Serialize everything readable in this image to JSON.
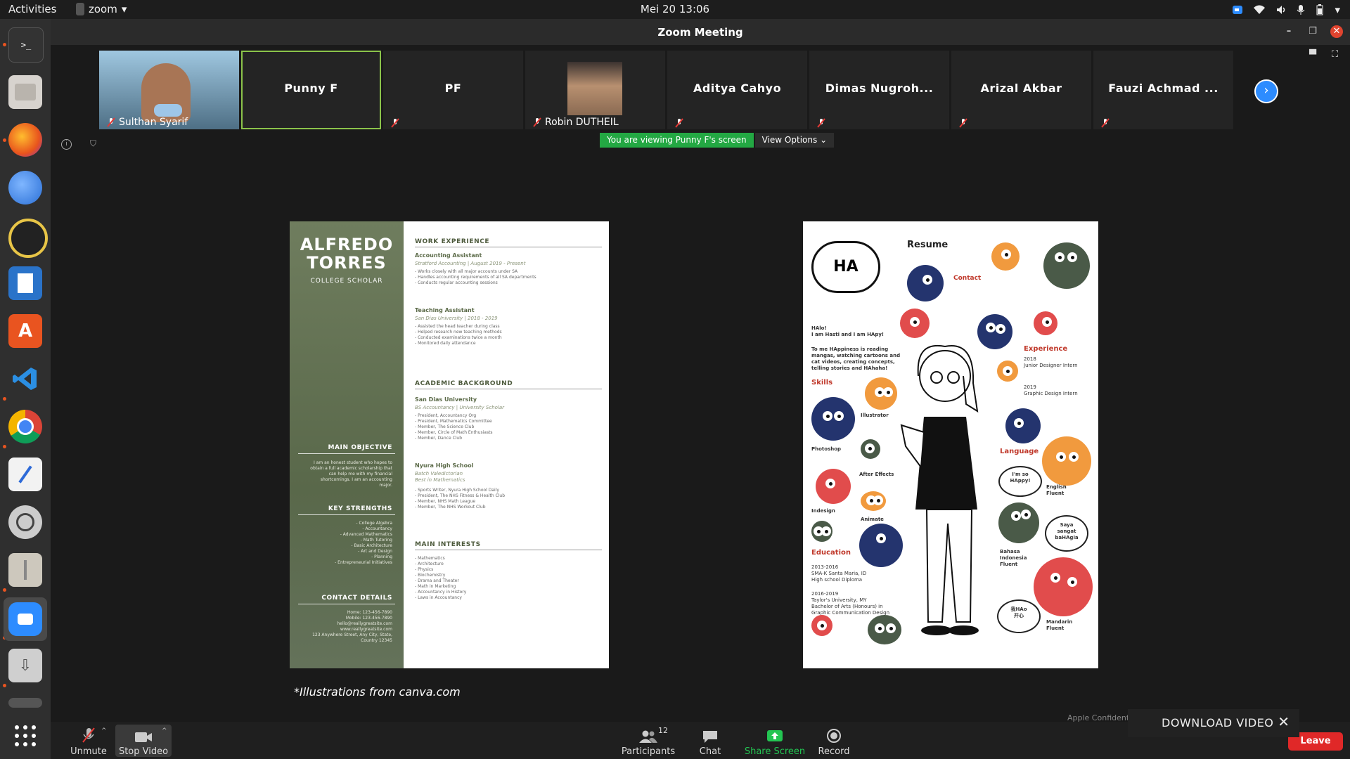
{
  "topbar": {
    "activities": "Activities",
    "app_name": "zoom",
    "clock": "Mei 20  13:06"
  },
  "window": {
    "title": "Zoom Meeting"
  },
  "participants_strip": [
    {
      "name": "Sulthan Syarif",
      "label": "Sulthan Syarif",
      "has_video": true,
      "muted": true,
      "active": false
    },
    {
      "name": "Punny F",
      "label": "",
      "has_video": false,
      "muted": false,
      "active": true
    },
    {
      "name": "PF",
      "label": "",
      "has_video": false,
      "muted": true,
      "active": false
    },
    {
      "name": "Robin DUTHEIL",
      "label": "Robin DUTHEIL",
      "has_video": true,
      "muted": true,
      "active": false
    },
    {
      "name": "Aditya Cahyo",
      "label": "",
      "has_video": false,
      "muted": true,
      "active": false
    },
    {
      "name": "Dimas Nugroh...",
      "label": "",
      "has_video": false,
      "muted": true,
      "active": false
    },
    {
      "name": "Arizal Akbar",
      "label": "",
      "has_video": false,
      "muted": true,
      "active": false
    },
    {
      "name": "Fauzi Achmad ...",
      "label": "",
      "has_video": false,
      "muted": true,
      "active": false
    }
  ],
  "share": {
    "notice": "You are viewing Punny F's screen",
    "view_options": "View Options"
  },
  "resume_left": {
    "first_name": "ALFREDO",
    "last_name": "TORRES",
    "subtitle": "COLLEGE SCHOLAR",
    "main_objective_head": "MAIN OBJECTIVE",
    "main_objective_text": "I am an honest student who hopes to obtain a full academic scholarship that can help me with my financial shortcomings. I am an accounting major.",
    "strengths_head": "KEY STRENGTHS",
    "strengths_text": "- College Algebra\n- Accountancy\n- Advanced Mathematics\n- Math Tutoring\n- Basic Architecture\n- Art and Design\n- Planning\n- Entrepreneurial Initiatives",
    "contact_head": "CONTACT DETAILS",
    "contact_text": "Home: 123-456-7890\nMobile: 123-456-7890\nhello@reallygreatsite.com\nwww.reallygreatsite.com\n123 Anywhere Street, Any City, State, Country 12345",
    "work_head": "WORK EXPERIENCE",
    "job1_title": "Accounting Assistant",
    "job1_meta": "Stratford Accounting | August 2019 - Present",
    "job1_bullets": "- Works closely with all major accounts under SA\n- Handles accounting requirements of all SA departments\n- Conducts regular accounting sessions",
    "job2_title": "Teaching Assistant",
    "job2_meta": "San Dias University | 2018 - 2019",
    "job2_bullets": "- Assisted the head teacher during class\n- Helped research new teaching methods\n- Conducted examinations twice a month\n- Monitored daily attendance",
    "academic_head": "ACADEMIC BACKGROUND",
    "school1": "San Dias University",
    "school1_meta": "BS Accountancy | University Scholar",
    "school1_bullets": "- President, Accountancy Org\n- President, Mathematics Committee\n- Member, The Science Club\n- Member, Circle of Math Enthusiasts\n- Member, Dance Club",
    "school2": "Nyura High School",
    "school2_meta": "Batch Valedictorian\nBest in Mathematics",
    "school2_bullets": "- Sports Writer, Nyura High School Daily\n- President, The NHS Fitness & Health Club\n- Member, NHS Math League\n- Member, The NHS Workout Club",
    "interests_head": "MAIN INTERESTS",
    "interests_bullets": "- Mathematics\n- Architecture\n- Physics\n- Biochemistry\n- Drama and Theater\n- Math in Marketing\n- Accountancy in History\n- Laws in Accountancy"
  },
  "resume_right": {
    "logo": "HA",
    "title": "Resume",
    "contact_head": "Contact",
    "intro": "HAlo!\nI am Hasti and I am HApy!",
    "about": "To me HAppiness is reading\nmangas, watching cartoons and\ncat videos, creating concepts,\ntelling stories and HAhaha!",
    "skills_head": "Skills",
    "skill_illustrator": "Illustrator",
    "skill_photoshop": "Photoshop",
    "skill_aftereffects": "After Effects",
    "skill_indesign": "Indesign",
    "skill_animate": "Animate",
    "experience_head": "Experience",
    "exp1": "2018\nJunior Designer Intern",
    "exp2": "2019\nGraphic Design Intern",
    "language_head": "Language",
    "lang1": "English\nFluent",
    "lang2": "Bahasa\nIndonesia\nFluent",
    "lang3": "Mandarin\nFluent",
    "bubble1": "I'm so\nHAppy!",
    "bubble2": "Saya\nsangat\nbaHAgia",
    "bubble3": "我HAo\n开心",
    "education_head": "Education",
    "edu1": "2013-2016\nSMA-K Santa Maria, ID\nHigh school Diploma",
    "edu2": "2016-2019\nTaylor's University, MY\nBachelor of Arts (Honours) in\nGraphic Communication Design"
  },
  "caption": "*Illustrations from canva.com",
  "confidential": "Apple Confidential",
  "download": {
    "label": "DOWNLOAD VIDEO"
  },
  "toolbar": {
    "unmute": "Unmute",
    "stop_video": "Stop Video",
    "participants": "Participants",
    "participants_count": "12",
    "chat": "Chat",
    "share_screen": "Share Screen",
    "record": "Record",
    "leave": "Leave"
  },
  "colors": {
    "share_green": "#23a843",
    "active_speaker": "#8bc34a",
    "leave_red": "#e02828",
    "ubuntu_orange": "#e95420"
  }
}
